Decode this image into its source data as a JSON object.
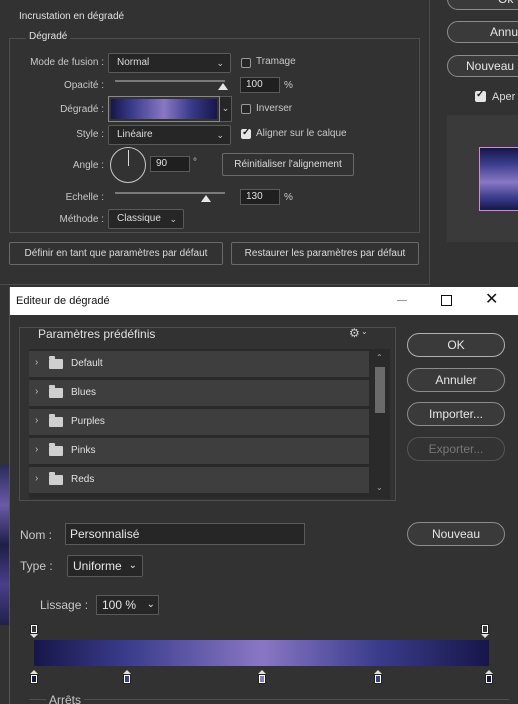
{
  "layer_style": {
    "section_title": "Incrustation en dégradé",
    "group_title": "Dégradé",
    "blend_mode_label": "Mode de fusion :",
    "blend_mode_value": "Normal",
    "dither_label": "Tramage",
    "opacity_label": "Opacité :",
    "opacity_value": "100",
    "opacity_unit": "%",
    "gradient_label": "Dégradé :",
    "reverse_label": "Inverser",
    "style_label": "Style :",
    "style_value": "Linéaire",
    "align_label": "Aligner sur le calque",
    "angle_label": "Angle :",
    "angle_value": "90",
    "angle_unit": "°",
    "reset_align_label": "Réinitialiser l'alignement",
    "scale_label": "Echelle :",
    "scale_value": "130",
    "scale_unit": "%",
    "method_label": "Méthode :",
    "method_value": "Classique",
    "make_default_label": "Définir en tant que paramètres par défaut",
    "reset_default_label": "Restaurer les paramètres par défaut",
    "dither_checked": false,
    "reverse_checked": false,
    "align_checked": true
  },
  "right_panel": {
    "ok_label": "Ok",
    "cancel_label": "Annul",
    "new_label": "Nouveau",
    "preview_label": "Aper",
    "preview_checked": true
  },
  "dialog": {
    "title": "Editeur de dégradé",
    "presets_title": "Paramètres prédéfinis",
    "presets": [
      "Default",
      "Blues",
      "Purples",
      "Pinks",
      "Reds"
    ],
    "ok_label": "OK",
    "cancel_label": "Annuler",
    "import_label": "Importer...",
    "export_label": "Exporter...",
    "name_label": "Nom :",
    "name_value": "Personnalisé",
    "new_label": "Nouveau",
    "type_label": "Type :",
    "type_value": "Uniforme",
    "smooth_label": "Lissage :",
    "smooth_value": "100 %",
    "stops_label": "Arrêts"
  },
  "gradient": {
    "colors": [
      "#17164a",
      "#3a3c8c",
      "#8977c4",
      "#3a3c8c",
      "#17164a"
    ],
    "stop_positions_pct": [
      0,
      20.5,
      50,
      75.5,
      100
    ]
  }
}
